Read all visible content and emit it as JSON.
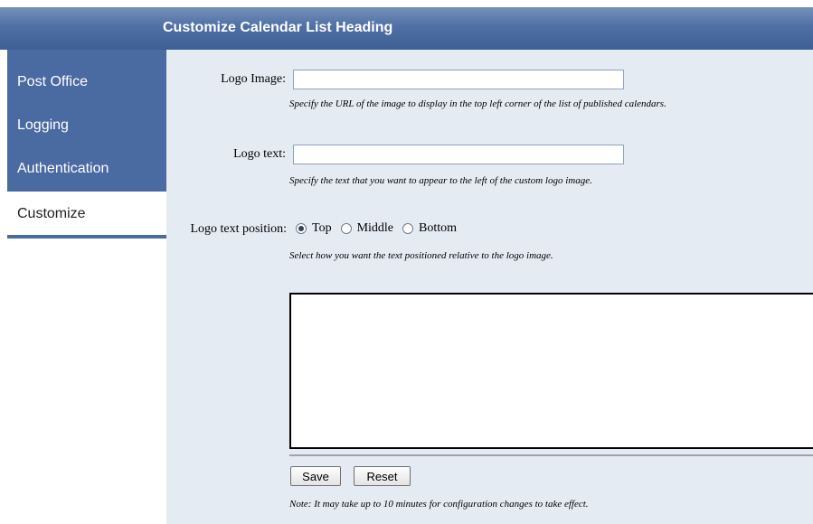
{
  "header": {
    "title": "Customize Calendar List Heading"
  },
  "sidebar": {
    "items": [
      {
        "label": "Post Office"
      },
      {
        "label": "Logging"
      },
      {
        "label": "Authentication"
      },
      {
        "label": "Customize",
        "active": true
      }
    ]
  },
  "form": {
    "logo_image": {
      "label": "Logo Image:",
      "value": "",
      "help": "Specify the URL of the image to display in the top left corner of the list of published calendars."
    },
    "logo_text": {
      "label": "Logo text:",
      "value": "",
      "help": "Specify the text that you want to appear to the left of the custom logo image."
    },
    "logo_text_position": {
      "label": "Logo text position:",
      "options": [
        "Top",
        "Middle",
        "Bottom"
      ],
      "selected": "Top",
      "help": "Select how you want the text positioned relative to the logo image."
    },
    "custom_html": {
      "value": ""
    },
    "save_label": "Save",
    "reset_label": "Reset",
    "note": "Note: It may take up to 10 minutes for configuration changes to take effect."
  },
  "colors": {
    "header_blue": "#4f70a4",
    "sidebar_blue": "#4a6aa2",
    "content_bg": "#e5ebf3"
  }
}
